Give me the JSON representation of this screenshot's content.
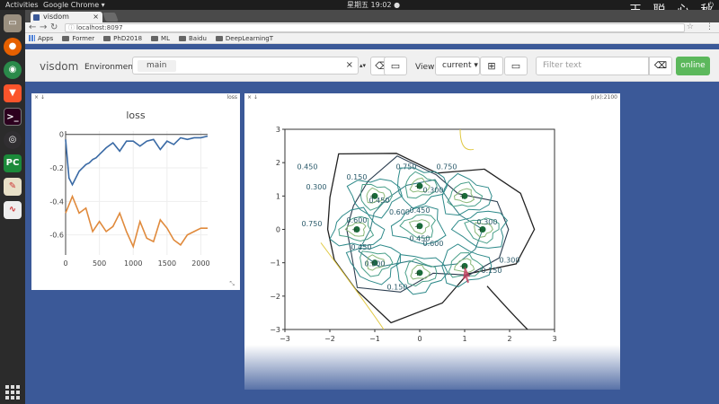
{
  "topbar": {
    "activities": "Activities",
    "app_name": "Google Chrome ▾",
    "clock": "星期五 19:02 ●",
    "watermark": "王 聪 心 秋"
  },
  "dock": [
    "files-icon",
    "firefox-icon",
    "chrome-icon",
    "brave-icon",
    "terminal-icon",
    "obs-icon",
    "pycharm-icon",
    "text-editor-icon",
    "evince-icon"
  ],
  "browser": {
    "tab_title": "visdom",
    "tab_close": "×",
    "url": "localhost:8097",
    "bookmarks": [
      "Apps",
      "Former",
      "PhD2018",
      "ML",
      "Baidu",
      "DeepLearningT"
    ]
  },
  "visdom": {
    "brand": "visdom",
    "environment_label": "Environment",
    "environment_value": "main",
    "clear_x": "×",
    "view_label": "View",
    "view_value": "current ▾",
    "filter_placeholder": "Filter text",
    "online_label": "online"
  },
  "panes": {
    "loss": {
      "controls": "× ↓",
      "title_right": "loss"
    },
    "contour": {
      "controls": "× ↓",
      "title_right": "p(x):2100"
    }
  },
  "chart_data": [
    {
      "type": "line",
      "title": "loss",
      "xlabel": "",
      "ylabel": "",
      "xlim": [
        0,
        2100
      ],
      "ylim": [
        -0.72,
        0.02
      ],
      "xticks": [
        0,
        500,
        1000,
        1500,
        2000
      ],
      "yticks": [
        0,
        -0.2,
        -0.4,
        -0.6
      ],
      "series": [
        {
          "color": "#3a6aa5",
          "x": [
            0,
            50,
            100,
            150,
            200,
            250,
            300,
            350,
            400,
            450,
            500,
            600,
            700,
            800,
            900,
            1000,
            1100,
            1200,
            1300,
            1400,
            1500,
            1600,
            1700,
            1800,
            1900,
            2000,
            2100
          ],
          "y": [
            -0.03,
            -0.26,
            -0.3,
            -0.26,
            -0.22,
            -0.2,
            -0.18,
            -0.17,
            -0.15,
            -0.14,
            -0.12,
            -0.08,
            -0.05,
            -0.1,
            -0.04,
            -0.04,
            -0.07,
            -0.04,
            -0.03,
            -0.09,
            -0.04,
            -0.06,
            -0.02,
            -0.03,
            -0.02,
            -0.02,
            -0.01
          ]
        },
        {
          "color": "#e08a3c",
          "x": [
            0,
            100,
            200,
            300,
            400,
            500,
            600,
            700,
            800,
            900,
            1000,
            1100,
            1200,
            1300,
            1400,
            1500,
            1600,
            1700,
            1800,
            1900,
            2000,
            2100
          ],
          "y": [
            -0.47,
            -0.37,
            -0.47,
            -0.44,
            -0.58,
            -0.52,
            -0.58,
            -0.55,
            -0.47,
            -0.58,
            -0.67,
            -0.52,
            -0.62,
            -0.64,
            -0.51,
            -0.56,
            -0.63,
            -0.66,
            -0.6,
            -0.58,
            -0.56,
            -0.56
          ]
        }
      ]
    },
    {
      "type": "contour",
      "xlim": [
        -3,
        3
      ],
      "ylim": [
        -3,
        3
      ],
      "xticks": [
        -3,
        -2,
        -1,
        0,
        1,
        2,
        3
      ],
      "yticks": [
        3,
        2,
        1,
        0,
        -1,
        -2,
        -3
      ],
      "contour_labels": [
        "0.450",
        "0.300",
        "0.150",
        "0.750",
        "0.450",
        "0.600",
        "0.450",
        "0.300",
        "0.150",
        "0.300",
        "0.450",
        "0.600",
        "0.750",
        "0.300",
        "0.750",
        "0.450",
        "0.600",
        "0.300",
        "0.150"
      ],
      "centers": [
        [
          -1,
          1
        ],
        [
          0,
          1.3
        ],
        [
          1,
          1
        ],
        [
          -1.4,
          0
        ],
        [
          0,
          0.1
        ],
        [
          1.4,
          0
        ],
        [
          -1,
          -1
        ],
        [
          0,
          -1.3
        ],
        [
          1,
          -1.1
        ]
      ]
    }
  ]
}
